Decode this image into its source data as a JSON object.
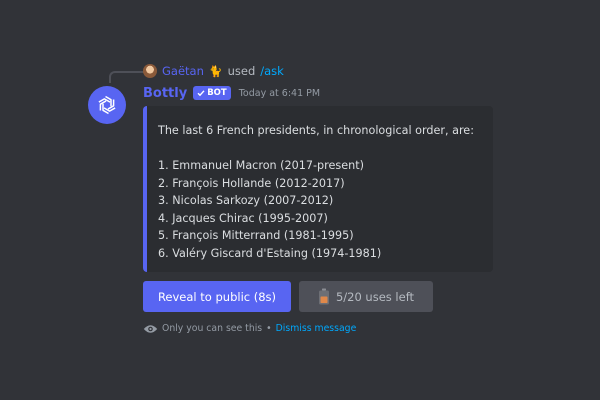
{
  "reply": {
    "username": "Gaëtan",
    "emoji": "🐈",
    "action": "used",
    "command": "/ask"
  },
  "message": {
    "author": "Bottly",
    "bot_tag": "BOT",
    "timestamp": "Today at 6:41 PM",
    "avatar_icon": "openai-logo-icon"
  },
  "embed": {
    "intro": "The last 6 French presidents, in chronological order, are:",
    "items": [
      "1. Emmanuel Macron (2017-present)",
      "2. François Hollande (2012-2017)",
      "3. Nicolas Sarkozy (2007-2012)",
      "4. Jacques Chirac (1995-2007)",
      "5. François Mitterrand (1981-1995)",
      "6. Valéry Giscard d'Estaing (1974-1981)"
    ],
    "accent_color": "#5865f2"
  },
  "buttons": {
    "reveal_label": "Reveal to public (8s)",
    "uses_label": "5/20 uses left",
    "uses_icon": "battery-icon"
  },
  "ephemeral": {
    "note": "Only you can see this",
    "separator": "•",
    "dismiss_label": "Dismiss message",
    "icon": "eye-icon"
  },
  "colors": {
    "background": "#313338",
    "embed_background": "#2b2d31",
    "brand": "#5865f2",
    "link": "#00a8fc"
  }
}
